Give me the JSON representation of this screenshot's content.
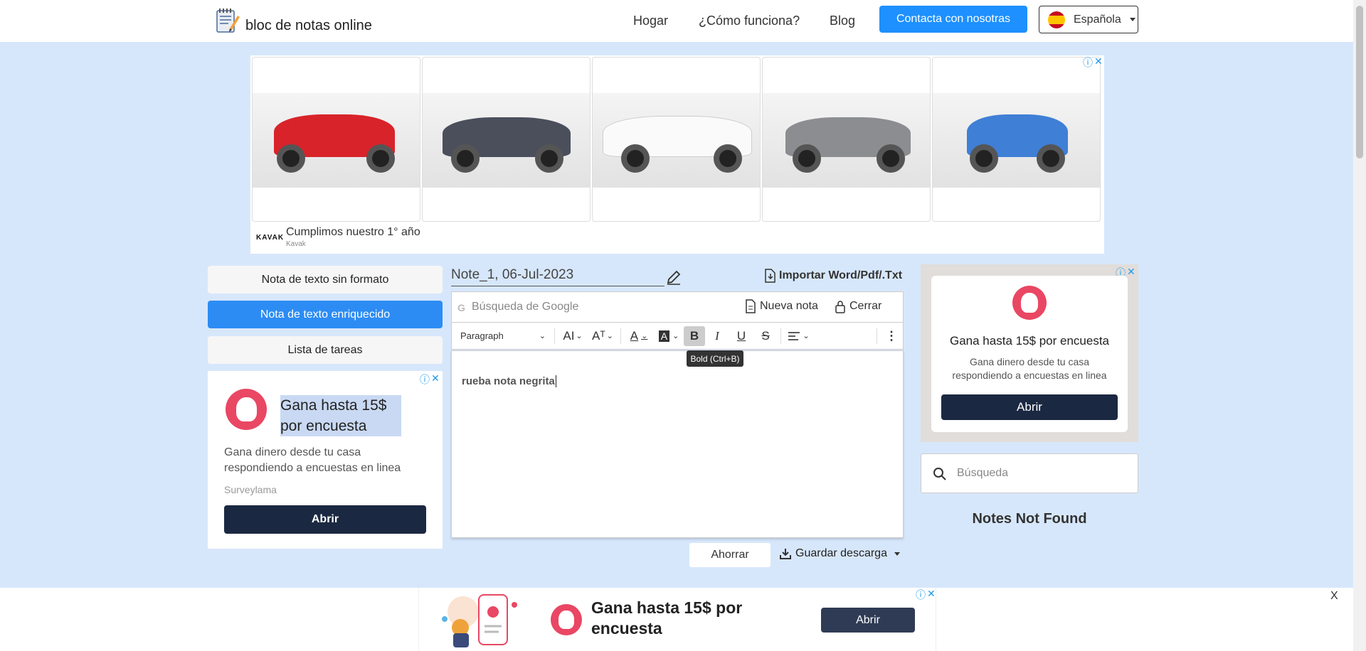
{
  "header": {
    "logo_text": "bloc de notas online",
    "nav": [
      "Hogar",
      "¿Cómo funciona?",
      "Blog"
    ],
    "contact_label": "Contacta con nosotras",
    "language": "Española"
  },
  "top_ad": {
    "brand_logo": "KAVAK",
    "title": "Cumplimos nuestro 1° año",
    "sponsor": "Kavak",
    "close": "✕",
    "info": "ⓘ"
  },
  "note_types": {
    "plain": "Nota de texto sin formato",
    "rich": "Nota de texto enriquecido",
    "tasks": "Lista de tareas"
  },
  "left_ad": {
    "headline": "Gana hasta 15$ por encuesta",
    "body": "Gana dinero desde tu casa respondiendo a encuestas en linea",
    "sponsor": "Surveylama",
    "cta": "Abrir"
  },
  "editor": {
    "note_title": "Note_1, 06-Jul-2023",
    "import_label": "Importar Word/Pdf/.Txt",
    "search_placeholder": "Búsqueda de Google",
    "new_note": "Nueva nota",
    "close": "Cerrar",
    "paragraph": "Paragraph",
    "content": "rueba nota negrita",
    "tooltip": "Bold (Ctrl+B)",
    "save": "Ahorrar",
    "download": "Guardar descarga"
  },
  "right_ad": {
    "headline": "Gana hasta 15$ por encuesta",
    "body": "Gana dinero desde tu casa respondiendo a encuestas en linea",
    "cta": "Abrir"
  },
  "sidebar": {
    "search_placeholder": "Búsqueda",
    "empty_message": "Notes Not Found"
  },
  "bottom_ad": {
    "headline": "Gana hasta 15$ por encuesta",
    "cta": "Abrir",
    "close": "X"
  },
  "colors": {
    "page_bg": "#d7e7fb",
    "primary_blue": "#1e90ff",
    "dark_button": "#1b2841",
    "llama_pink": "#e94763"
  }
}
